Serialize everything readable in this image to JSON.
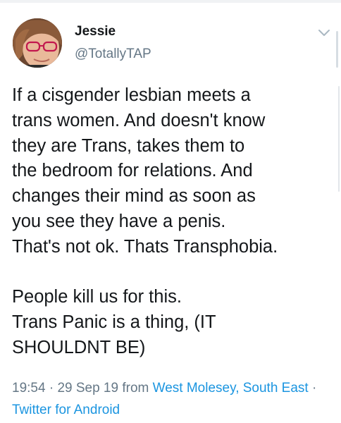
{
  "author": {
    "display_name": "Jessie",
    "handle": "@TotallyTAP"
  },
  "tweet": {
    "text": "If a cisgender lesbian meets a\ntrans women. And doesn't know\nthey are Trans, takes them to\nthe bedroom for relations. And\nchanges their mind as soon as\nyou see they have a penis.\nThat's not ok. Thats Transphobia.\n\nPeople kill us for this.\nTrans Panic is a thing, (IT\nSHOULDNT BE)"
  },
  "meta": {
    "time": "19:54",
    "date": "29 Sep 19",
    "from_label": "from",
    "location": "West Molesey, South East",
    "source": "Twitter for Android",
    "separator": "·"
  },
  "icons": {
    "caret": "chevron-down-icon",
    "avatar": "avatar"
  },
  "colors": {
    "text": "#14171a",
    "secondary": "#657786",
    "link": "#1b95e0"
  }
}
